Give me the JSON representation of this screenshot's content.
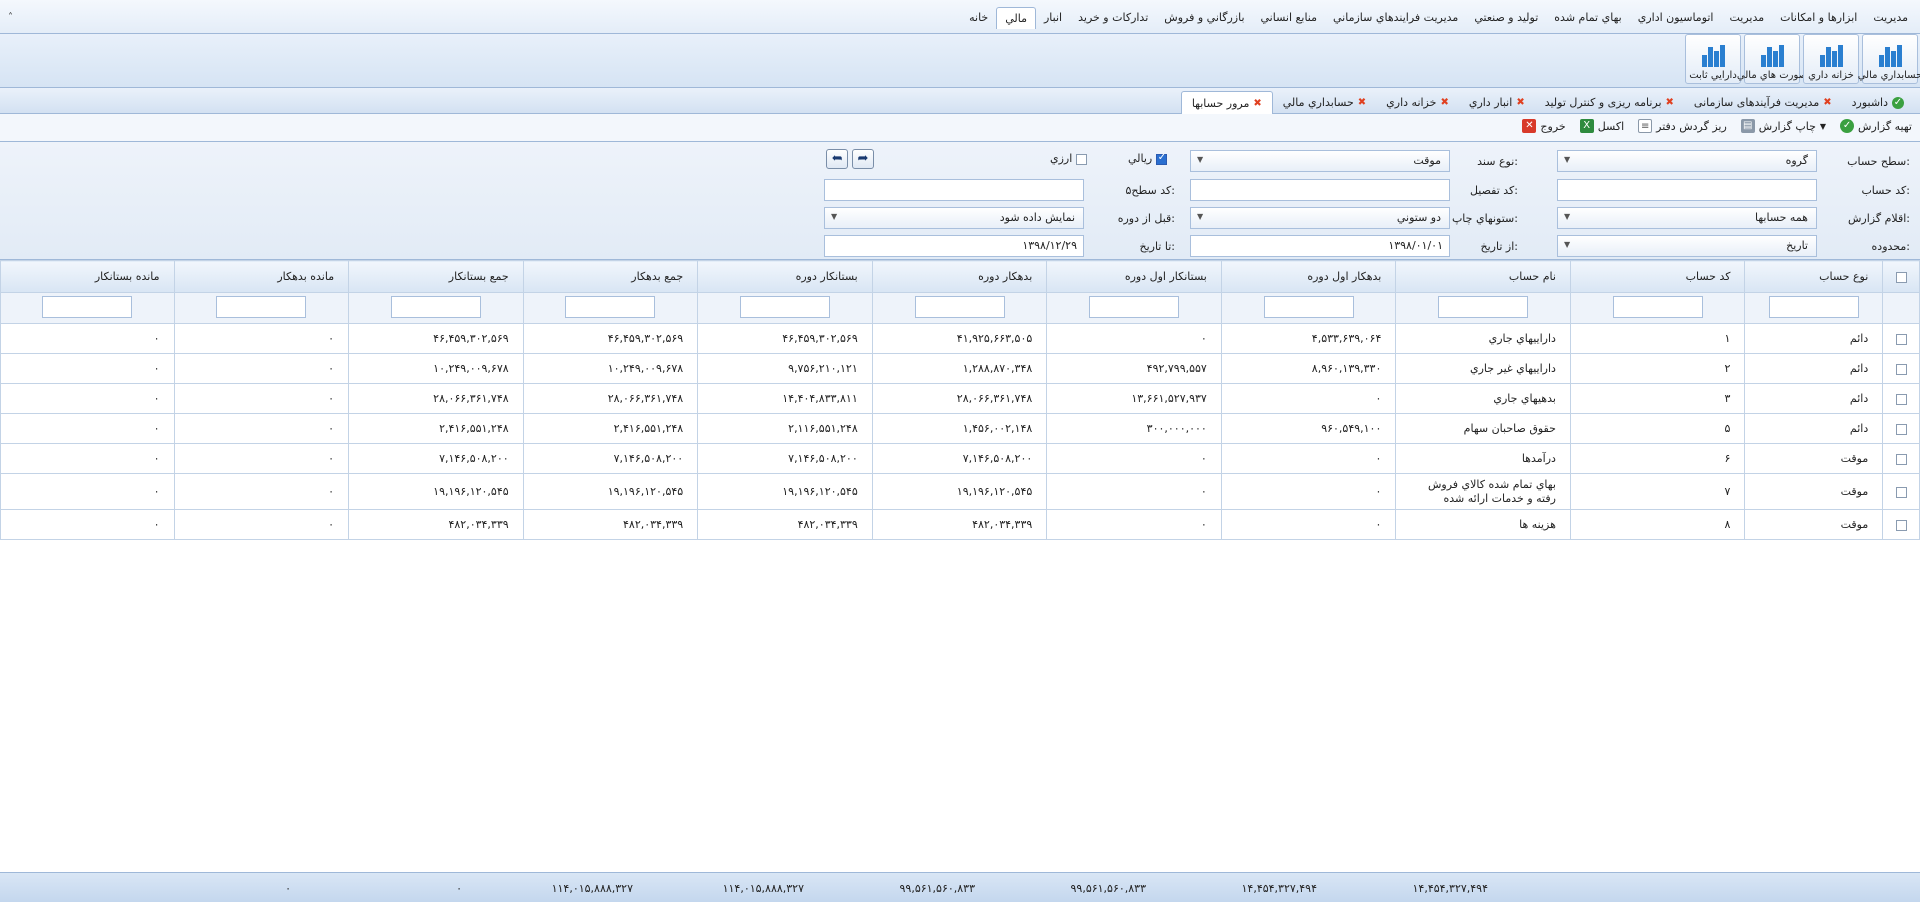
{
  "menubar": {
    "collapse_glyph": "˄",
    "items": [
      "خانه",
      "مالي",
      "انبار",
      "تدارکات و خرید",
      "بازرگاني و فروش",
      "منابع انساني",
      "مدیریت فرایندهاي سازماني",
      "تولید و صنعتي",
      "بهاي تمام شده",
      "اتوماسیون اداري",
      "مدیریت",
      "ابزارها و امکانات",
      "مدیریت"
    ],
    "active_index": 1
  },
  "ribbon": {
    "buttons": [
      "حسابداري مالي",
      "خزانه داري",
      "صورت هاي مالي",
      "دارایي ثابت"
    ]
  },
  "tabs": {
    "items": [
      {
        "label": "داشبورد",
        "closable": false
      },
      {
        "label": "مدیریت فرآیندهای سازمانی",
        "closable": true
      },
      {
        "label": "برنامه ریزی و کنترل تولید",
        "closable": true
      },
      {
        "label": "انبار داري",
        "closable": true
      },
      {
        "label": "خزانه داري",
        "closable": true
      },
      {
        "label": "حسابداري مالي",
        "closable": true
      },
      {
        "label": "مرور حسابها",
        "closable": true
      }
    ],
    "active_index": 6
  },
  "toolbar": {
    "prepare": "تهیه گزارش",
    "print": "چاپ گزارش",
    "ledger": "ریز گردش دفتر",
    "excel": "اکسل",
    "exit": "خروج"
  },
  "filters": {
    "level_label": "سطح حساب:",
    "level_value": "گروه",
    "doc_type_label": "نوع سند:",
    "doc_type_value": "موقت",
    "rial_label": "ریالي",
    "rial_checked": true,
    "currency_label": "ارزي",
    "currency_checked": false,
    "account_code_label": "کد حساب:",
    "detail_code_label": "کد تفصیل:",
    "level5_code_label": "کد سطح۵:",
    "report_items_label": "اقلام گزارش:",
    "report_items_value": "همه حسابها",
    "print_columns_label": "ستونهاي چاپ:",
    "print_columns_value": "دو ستوني",
    "before_period_label": "قبل از دوره:",
    "before_period_value": "نمایش داده شود",
    "range_label": "محدوده:",
    "range_value": "تاریخ",
    "from_date_label": "از تاریخ:",
    "from_date_value": "۱۳۹۸/۰۱/۰۱",
    "to_date_label": "تا تاریخ:",
    "to_date_value": "۱۳۹۸/۱۲/۲۹"
  },
  "grid": {
    "columns": [
      "نوع حساب",
      "کد حساب",
      "نام حساب",
      "بدهکار اول دوره",
      "بستانکار اول دوره",
      "بدهکار دوره",
      "بستانکار دوره",
      "جمع بدهکار",
      "جمع بستانکار",
      "مانده بدهکار",
      "مانده بستانکار"
    ],
    "rows": [
      [
        "دائم",
        "۱",
        "دارایيهاي جاري",
        "۴,۵۳۳,۶۳۹,۰۶۴",
        "۰",
        "۴۱,۹۲۵,۶۶۳,۵۰۵",
        "۴۶,۴۵۹,۳۰۲,۵۶۹",
        "۴۶,۴۵۹,۳۰۲,۵۶۹",
        "۴۶,۴۵۹,۳۰۲,۵۶۹",
        "۰",
        "۰"
      ],
      [
        "دائم",
        "۲",
        "دارایيهاي غیر جاري",
        "۸,۹۶۰,۱۳۹,۳۳۰",
        "۴۹۲,۷۹۹,۵۵۷",
        "۱,۲۸۸,۸۷۰,۳۴۸",
        "۹,۷۵۶,۲۱۰,۱۲۱",
        "۱۰,۲۴۹,۰۰۹,۶۷۸",
        "۱۰,۲۴۹,۰۰۹,۶۷۸",
        "۰",
        "۰"
      ],
      [
        "دائم",
        "۳",
        "بدهیهاي جاري",
        "۰",
        "۱۳,۶۶۱,۵۲۷,۹۳۷",
        "۲۸,۰۶۶,۳۶۱,۷۴۸",
        "۱۴,۴۰۴,۸۳۳,۸۱۱",
        "۲۸,۰۶۶,۳۶۱,۷۴۸",
        "۲۸,۰۶۶,۳۶۱,۷۴۸",
        "۰",
        "۰"
      ],
      [
        "دائم",
        "۵",
        "حقوق صاحبان سهام",
        "۹۶۰,۵۴۹,۱۰۰",
        "۳۰۰,۰۰۰,۰۰۰",
        "۱,۴۵۶,۰۰۲,۱۴۸",
        "۲,۱۱۶,۵۵۱,۲۴۸",
        "۲,۴۱۶,۵۵۱,۲۴۸",
        "۲,۴۱۶,۵۵۱,۲۴۸",
        "۰",
        "۰"
      ],
      [
        "موقت",
        "۶",
        "درآمدها",
        "۰",
        "۰",
        "۷,۱۴۶,۵۰۸,۲۰۰",
        "۷,۱۴۶,۵۰۸,۲۰۰",
        "۷,۱۴۶,۵۰۸,۲۰۰",
        "۷,۱۴۶,۵۰۸,۲۰۰",
        "۰",
        "۰"
      ],
      [
        "موقت",
        "۷",
        "بهاي تمام شده کالاي فروش رفته و خدمات ارائه شده",
        "۰",
        "۰",
        "۱۹,۱۹۶,۱۲۰,۵۴۵",
        "۱۹,۱۹۶,۱۲۰,۵۴۵",
        "۱۹,۱۹۶,۱۲۰,۵۴۵",
        "۱۹,۱۹۶,۱۲۰,۵۴۵",
        "۰",
        "۰"
      ],
      [
        "موقت",
        "۸",
        "هزینه ها",
        "۰",
        "۰",
        "۴۸۲,۰۳۴,۳۳۹",
        "۴۸۲,۰۳۴,۳۳۹",
        "۴۸۲,۰۳۴,۳۳۹",
        "۴۸۲,۰۳۴,۳۳۹",
        "۰",
        "۰"
      ]
    ],
    "totals": [
      "۱۴,۴۵۴,۳۲۷,۴۹۴",
      "۱۴,۴۵۴,۳۲۷,۴۹۴",
      "۹۹,۵۶۱,۵۶۰,۸۳۳",
      "۹۹,۵۶۱,۵۶۰,۸۳۳",
      "۱۱۴,۰۱۵,۸۸۸,۳۲۷",
      "۱۱۴,۰۱۵,۸۸۸,۳۲۷",
      "۰",
      "۰"
    ]
  },
  "colors": {
    "accent": "#2a7fd0",
    "header": "#d8e5f4",
    "border": "#9fb8d8"
  }
}
